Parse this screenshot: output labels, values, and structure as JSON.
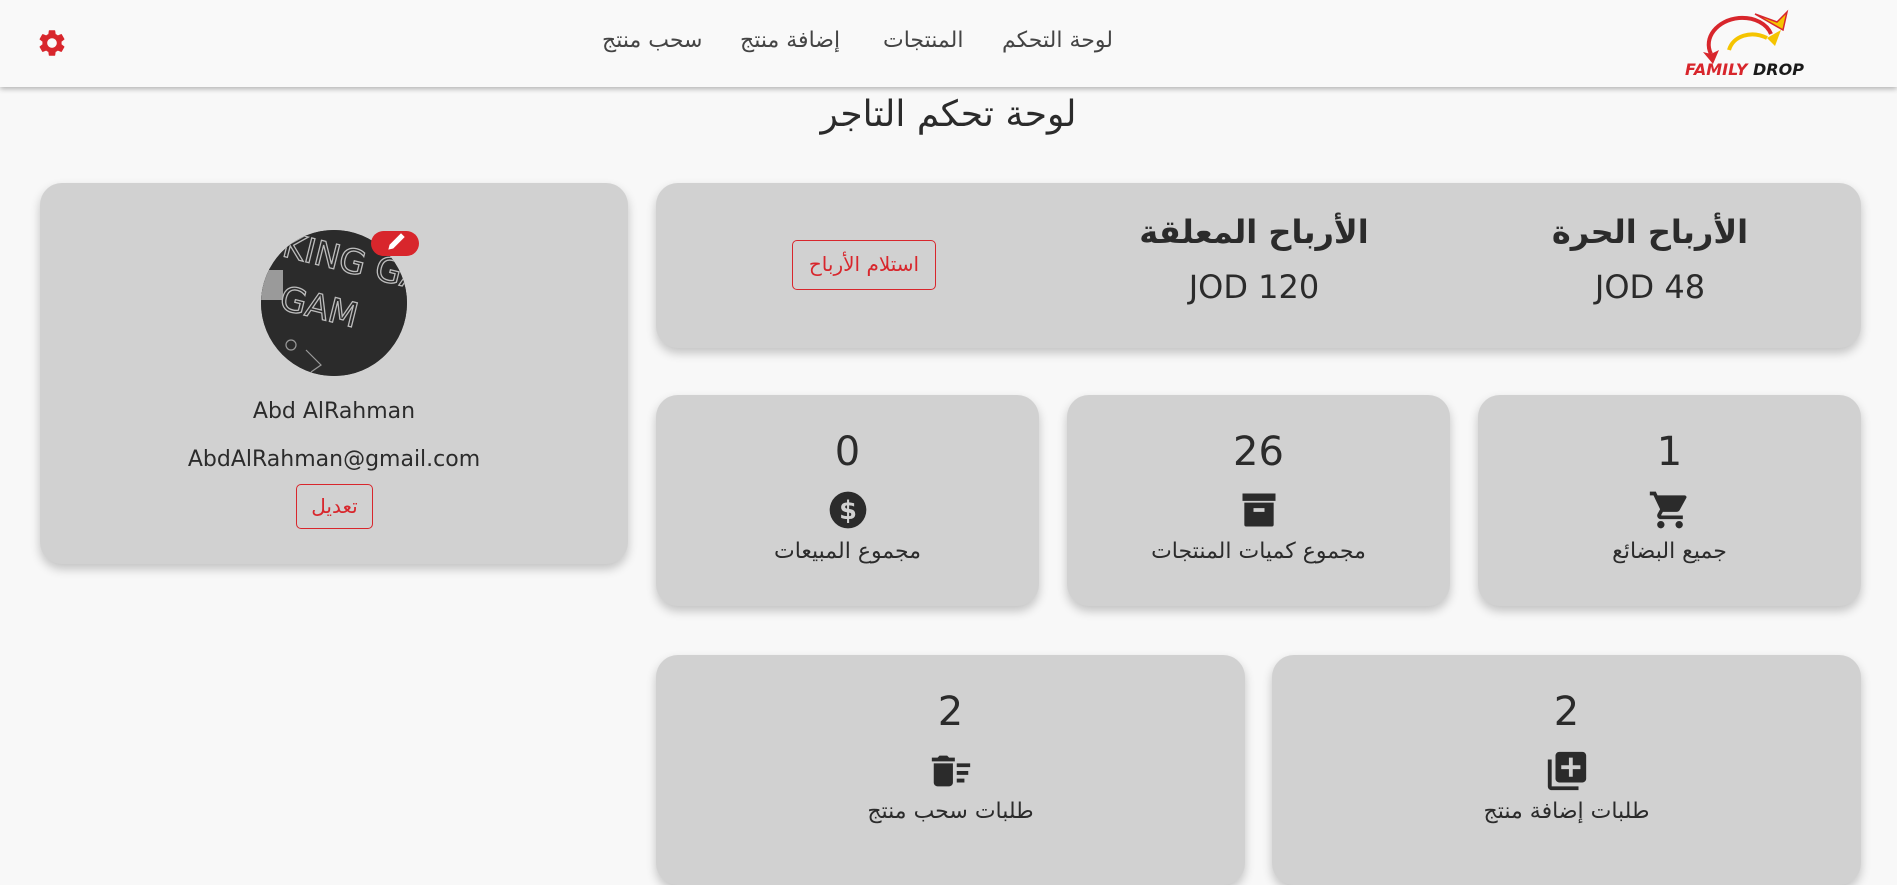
{
  "nav": {
    "dashboard": "لوحة التحكم",
    "products": "المنتجات",
    "add_product": "إضافة منتج",
    "withdraw_product": "سحب منتج"
  },
  "logo": {
    "word1": "FAMILY",
    "word2": "DROP"
  },
  "page_title": "لوحة تحكم التاجر",
  "profile": {
    "name": "Abd AlRahman",
    "email": "AbdAlRahman@gmail.com",
    "edit_label": "تعديل",
    "avatar_text": "KING GAM"
  },
  "earnings": {
    "free_title": "الأرباح الحرة",
    "free_value": "JOD 48",
    "pending_title": "الأرباح المعلقة",
    "pending_value": "JOD 120",
    "withdraw_label": "استلام الأرباح"
  },
  "stats": {
    "all_goods": {
      "value": "1",
      "label": "جميع البضائع",
      "icon": "cart-icon"
    },
    "product_quantities": {
      "value": "26",
      "label": "مجموع كميات المنتجات",
      "icon": "archive-icon"
    },
    "total_sales": {
      "value": "0",
      "label": "مجموع المبيعات",
      "icon": "dollar-icon"
    },
    "add_requests": {
      "value": "2",
      "label": "طلبات إضافة منتج",
      "icon": "add-box-icon"
    },
    "withdraw_requests": {
      "value": "2",
      "label": "طلبات سحب منتج",
      "icon": "delete-sweep-icon"
    }
  },
  "colors": {
    "accent": "#d8262c",
    "card": "#d1d1d1",
    "background": "#f8f8f8",
    "logo_yellow": "#f5c400"
  }
}
